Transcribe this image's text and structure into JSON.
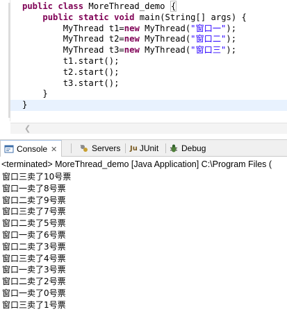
{
  "editor": {
    "lines": [
      {
        "indent": "",
        "tokens": [
          {
            "t": "kw",
            "v": "public"
          },
          {
            "t": "plain",
            "v": " "
          },
          {
            "t": "kw",
            "v": "class"
          },
          {
            "t": "plain",
            "v": " MoreThread_demo "
          },
          {
            "t": "box",
            "v": "{"
          }
        ]
      },
      {
        "indent": "    ",
        "tokens": [
          {
            "t": "kw",
            "v": "public"
          },
          {
            "t": "plain",
            "v": " "
          },
          {
            "t": "kw",
            "v": "static"
          },
          {
            "t": "plain",
            "v": " "
          },
          {
            "t": "kw",
            "v": "void"
          },
          {
            "t": "plain",
            "v": " main(String[] args) {"
          }
        ]
      },
      {
        "indent": "        ",
        "tokens": [
          {
            "t": "plain",
            "v": "MyThread t1="
          },
          {
            "t": "kw",
            "v": "new"
          },
          {
            "t": "plain",
            "v": " MyThread("
          },
          {
            "t": "str",
            "v": "\"窗口一\""
          },
          {
            "t": "plain",
            "v": ");"
          }
        ]
      },
      {
        "indent": "        ",
        "tokens": [
          {
            "t": "plain",
            "v": "MyThread t2="
          },
          {
            "t": "kw",
            "v": "new"
          },
          {
            "t": "plain",
            "v": " MyThread("
          },
          {
            "t": "str",
            "v": "\"窗口二\""
          },
          {
            "t": "plain",
            "v": ");"
          }
        ]
      },
      {
        "indent": "        ",
        "tokens": [
          {
            "t": "plain",
            "v": "MyThread t3="
          },
          {
            "t": "kw",
            "v": "new"
          },
          {
            "t": "plain",
            "v": " MyThread("
          },
          {
            "t": "str",
            "v": "\"窗口三\""
          },
          {
            "t": "plain",
            "v": ");"
          }
        ]
      },
      {
        "indent": "        ",
        "tokens": [
          {
            "t": "plain",
            "v": "t1.start();"
          }
        ]
      },
      {
        "indent": "        ",
        "tokens": [
          {
            "t": "plain",
            "v": "t2.start();"
          }
        ]
      },
      {
        "indent": "        ",
        "tokens": [
          {
            "t": "plain",
            "v": "t3.start();"
          }
        ]
      },
      {
        "indent": "    ",
        "tokens": [
          {
            "t": "plain",
            "v": "}"
          }
        ]
      },
      {
        "indent": "",
        "tokens": [
          {
            "t": "plain",
            "v": "}"
          }
        ],
        "current": true
      }
    ]
  },
  "tabs": {
    "console": "Console",
    "close": "✕",
    "servers": "Servers",
    "junit": "JUnit",
    "debug": "Debug"
  },
  "console": {
    "status": "<terminated> MoreThread_demo [Java Application] C:\\Program Files (",
    "output": [
      "窗口三卖了10号票",
      "窗口一卖了8号票",
      "窗口二卖了9号票",
      "窗口三卖了7号票",
      "窗口二卖了5号票",
      "窗口一卖了6号票",
      "窗口二卖了3号票",
      "窗口三卖了4号票",
      "窗口一卖了3号票",
      "窗口二卖了2号票",
      "窗口一卖了0号票",
      "窗口三卖了1号票"
    ]
  },
  "colors": {
    "keyword": "#7f0055",
    "string": "#2a00ff",
    "current_line": "#e8f2fe"
  }
}
